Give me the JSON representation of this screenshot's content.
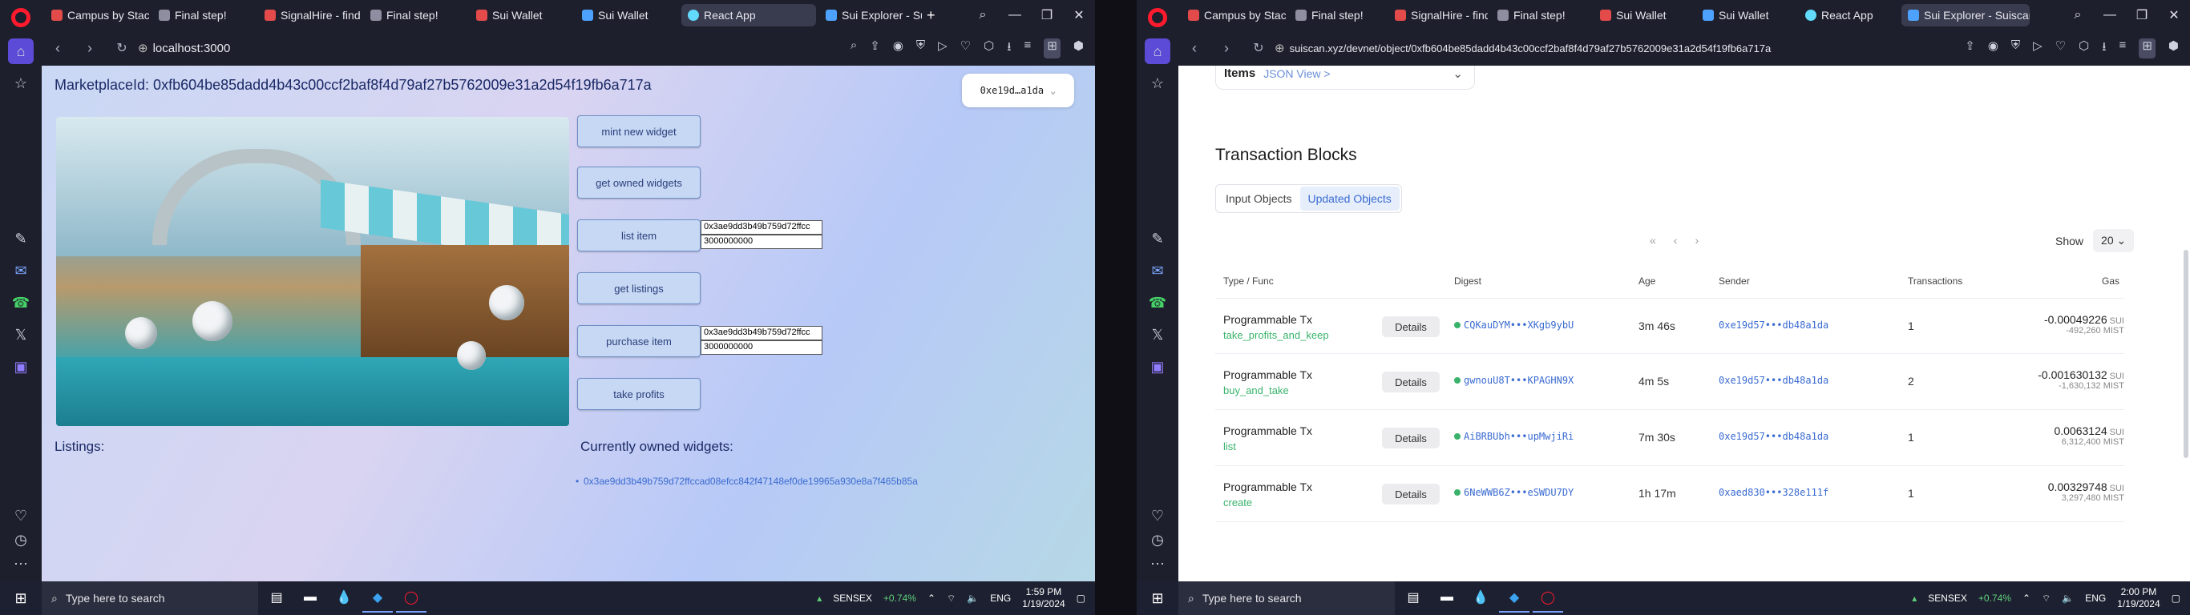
{
  "left": {
    "tabs": [
      {
        "label": "Campus by StackU",
        "color": "#e34b4b"
      },
      {
        "label": "Final step!",
        "color": "#8e8ea0"
      },
      {
        "label": "SignalHire - find c",
        "color": "#e34b4b"
      },
      {
        "label": "Final step!",
        "color": "#8e8ea0"
      },
      {
        "label": "Sui Wallet",
        "color": "#e34b4b"
      },
      {
        "label": "Sui Wallet",
        "color": "#4da2ff"
      },
      {
        "label": "React App",
        "color": "#61dafb"
      },
      {
        "label": "Sui Explorer - Suis",
        "color": "#4da2ff"
      }
    ],
    "url": "localhost:3000",
    "marketplace_title": "MarketplaceId: 0xfb604be85dadd4b43c00ccf2baf8f4d79af27b5762009e31a2d54f19fb6a717a",
    "wallet_label": "0xe19d…a1da",
    "buttons": {
      "mint": "mint new widget",
      "owned": "get owned widgets",
      "list": "list item",
      "listings": "get listings",
      "purchase": "purchase item",
      "profits": "take profits"
    },
    "list_inputs": {
      "item": "0x3ae9dd3b49b759d72ffcc",
      "price": "3000000000"
    },
    "purchase_inputs": {
      "item": "0x3ae9dd3b49b759d72ffcc",
      "price": "3000000000"
    },
    "listings_heading": "Listings:",
    "owned_heading": "Currently owned widgets:",
    "owned_widgets": [
      "0x3ae9dd3b49b759d72ffccad08efcc842f47148ef0de19965a930e8a7f465b85a"
    ]
  },
  "right": {
    "tabs": [
      {
        "label": "Campus by StackU",
        "color": "#e34b4b"
      },
      {
        "label": "Final step!",
        "color": "#8e8ea0"
      },
      {
        "label": "SignalHire - find c",
        "color": "#e34b4b"
      },
      {
        "label": "Final step!",
        "color": "#8e8ea0"
      },
      {
        "label": "Sui Wallet",
        "color": "#e34b4b"
      },
      {
        "label": "Sui Wallet",
        "color": "#4da2ff"
      },
      {
        "label": "React App",
        "color": "#61dafb"
      },
      {
        "label": "Sui Explorer - Suiscan",
        "color": "#4da2ff"
      }
    ],
    "url": "suiscan.xyz/devnet/object/0xfb604be85dadd4b43c00ccf2baf8f4d79af27b5762009e31a2d54f19fb6a717a",
    "items_label": "Items",
    "json_view": "JSON View >",
    "tx_title": "Transaction Blocks",
    "seg": {
      "input": "Input Objects",
      "updated": "Updated Objects"
    },
    "show_label": "Show",
    "show_value": "20",
    "columns": {
      "type": "Type / Func",
      "digest": "Digest",
      "age": "Age",
      "sender": "Sender",
      "txns": "Transactions",
      "gas": "Gas"
    },
    "rows": [
      {
        "type": "Programmable Tx",
        "func": "take_profits_and_keep",
        "details": "Details",
        "digest": "CQKauDYM•••XKgb9ybU",
        "age": "3m 46s",
        "sender": "0xe19d57•••db48a1da",
        "txns": "1",
        "gas": "-0.00049226",
        "unit": "SUI",
        "mist": "-492,260 MIST"
      },
      {
        "type": "Programmable Tx",
        "func": "buy_and_take",
        "details": "Details",
        "digest": "gwnouU8T•••KPAGHN9X",
        "age": "4m 5s",
        "sender": "0xe19d57•••db48a1da",
        "txns": "2",
        "gas": "-0.001630132",
        "unit": "SUI",
        "mist": "-1,630,132 MIST"
      },
      {
        "type": "Programmable Tx",
        "func": "list",
        "details": "Details",
        "digest": "AiBRBUbh•••upMwjiRi",
        "age": "7m 30s",
        "sender": "0xe19d57•••db48a1da",
        "txns": "1",
        "gas": "0.0063124",
        "unit": "SUI",
        "mist": "6,312,400 MIST"
      },
      {
        "type": "Programmable Tx",
        "func": "create",
        "details": "Details",
        "digest": "6NeWWB6Z•••eSWDU7DY",
        "age": "1h 17m",
        "sender": "0xaed830•••328e111f",
        "txns": "1",
        "gas": "0.00329748",
        "unit": "SUI",
        "mist": "3,297,480 MIST"
      }
    ]
  },
  "taskbar": {
    "search_placeholder": "Type here to search",
    "stock_name": "SENSEX",
    "stock_change": "+0.74%",
    "lang": "ENG",
    "left_time": "1:59 PM",
    "right_time": "2:00 PM",
    "date": "1/19/2024"
  }
}
